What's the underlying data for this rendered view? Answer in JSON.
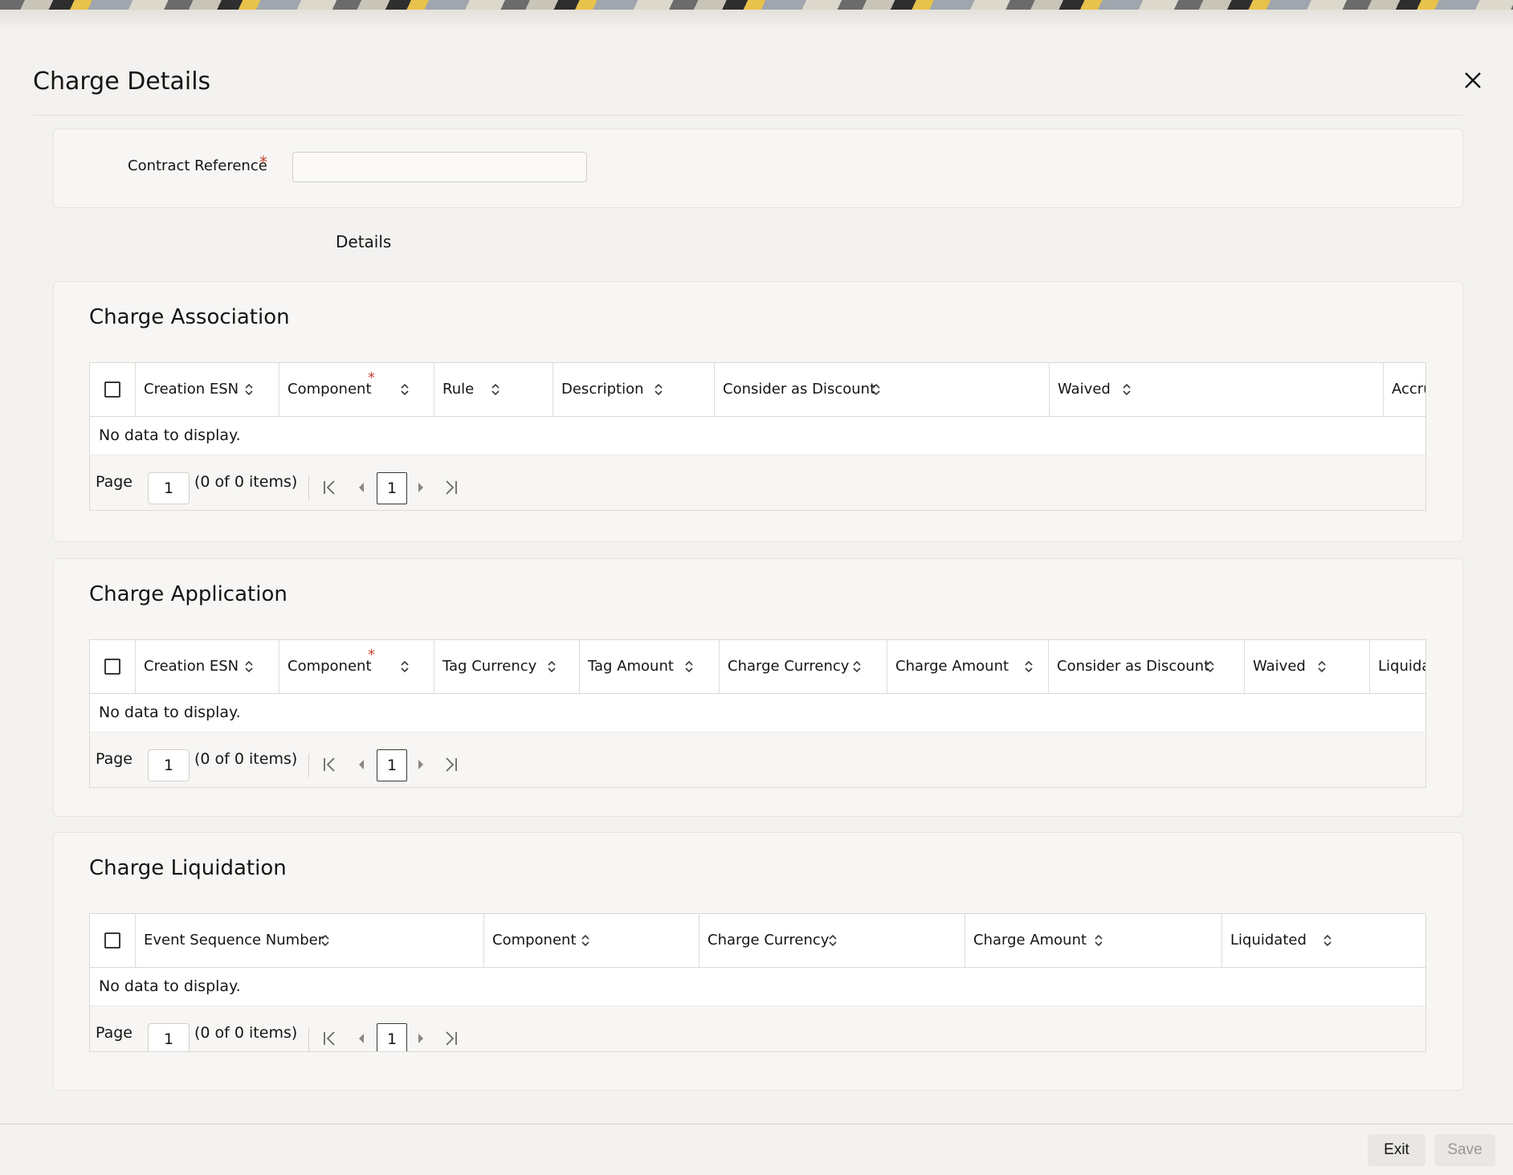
{
  "dialog": {
    "title": "Charge Details",
    "close_icon": "close-icon"
  },
  "header_form": {
    "contract_reference_label": "Contract Reference",
    "required_marker": "*",
    "contract_reference_value": ""
  },
  "tabs": [
    {
      "label": "Details",
      "active": true
    }
  ],
  "sections": [
    {
      "title": "Charge Association",
      "columns": [
        {
          "label": "Creation ESN",
          "required": false
        },
        {
          "label": "Component",
          "required": true
        },
        {
          "label": "Rule",
          "required": false
        },
        {
          "label": "Description",
          "required": false
        },
        {
          "label": "Consider as Discount",
          "required": false
        },
        {
          "label": "Waived",
          "required": false
        },
        {
          "label": "Accru",
          "required": false
        }
      ],
      "empty_text": "No data to display.",
      "pager": {
        "page_label": "Page",
        "page_value": "1",
        "count_text": "(0 of 0 items)",
        "current_page": "1"
      }
    },
    {
      "title": "Charge Application",
      "columns": [
        {
          "label": "Creation ESN",
          "required": false
        },
        {
          "label": "Component",
          "required": true
        },
        {
          "label": "Tag Currency",
          "required": false
        },
        {
          "label": "Tag Amount",
          "required": false
        },
        {
          "label": "Charge Currency",
          "required": false
        },
        {
          "label": "Charge Amount",
          "required": false
        },
        {
          "label": "Consider as Discount",
          "required": false
        },
        {
          "label": "Waived",
          "required": false
        },
        {
          "label": "Liquidat",
          "required": false
        }
      ],
      "empty_text": "No data to display.",
      "pager": {
        "page_label": "Page",
        "page_value": "1",
        "count_text": "(0 of 0 items)",
        "current_page": "1"
      }
    },
    {
      "title": "Charge Liquidation",
      "columns": [
        {
          "label": "Event Sequence Number",
          "required": false
        },
        {
          "label": "Component",
          "required": false
        },
        {
          "label": "Charge Currency",
          "required": false
        },
        {
          "label": "Charge Amount",
          "required": false
        },
        {
          "label": "Liquidated",
          "required": false
        }
      ],
      "empty_text": "No data to display.",
      "pager": {
        "page_label": "Page",
        "page_value": "1",
        "count_text": "(0 of 0 items)",
        "current_page": "1"
      }
    }
  ],
  "footer": {
    "exit_label": "Exit",
    "save_label": "Save",
    "save_enabled": false
  },
  "colors": {
    "required": "#c74634",
    "text": "#161513",
    "panel_bg": "#f7f6f4",
    "page_bg": "#f3f2f0"
  }
}
